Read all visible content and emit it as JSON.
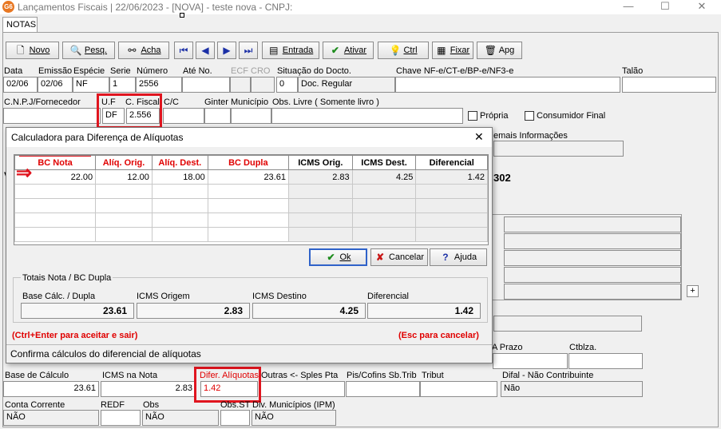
{
  "window": {
    "title": "Lançamentos Fiscais | 22/06/2023 - [NOVA] - teste nova - CNPJ:",
    "logo": "G6",
    "minimize": "—",
    "maximize": "☐",
    "close": "✕"
  },
  "tab": "NOTAS",
  "toolbar": {
    "novo": "Novo",
    "pesq": "Pesq.",
    "acha": "Acha",
    "entrada": "Entrada",
    "ativar": "Ativar",
    "ctrl": "Ctrl",
    "fixar": "Fixar",
    "apg": "Apg"
  },
  "row1": {
    "labels": {
      "data": "Data",
      "emissao": "Emissão",
      "especie": "Espécie",
      "serie": "Serie",
      "numero": "Número",
      "ate_no": "Até No.",
      "ecf": "ECF",
      "cro": "CRO",
      "situacao": "Situação do Docto.",
      "chave": "Chave NF-e/CT-e/BP-e/NF3-e",
      "talao": "Talão"
    },
    "values": {
      "data": "02/06",
      "emissao": "02/06",
      "especie": "NF",
      "serie": "1",
      "numero": "2556",
      "situacao_code": "0",
      "situacao_text": "Doc. Regular"
    }
  },
  "row2": {
    "labels": {
      "cnpj": "C.N.P.J/Fornecedor",
      "uf": "U.F",
      "cfiscal": "C. Fiscal",
      "cc": "C/C",
      "ginter": "Ginter",
      "municipio": "Município",
      "obs_livre": "Obs. Livre ( Somente livro )",
      "propria": "Própria",
      "consumidor": "Consumidor Final"
    },
    "values": {
      "uf": "DF",
      "cfiscal": "2.556"
    }
  },
  "background": {
    "demais": "emais Informações",
    "num302": "302",
    "plus": "+",
    "a_prazo": "A Prazo",
    "ctblza": "Ctblza."
  },
  "dialog": {
    "title": "Calculadora para Diferença de Alíquotas",
    "close": "✕",
    "arrow": "⇒",
    "columns": [
      "BC Nota",
      "Alíq. Orig.",
      "Alíq. Dest.",
      "BC Dupla",
      "ICMS Orig.",
      "ICMS Dest.",
      "Diferencial"
    ],
    "rows": [
      [
        "22.00",
        "12.00",
        "18.00",
        "23.61",
        "2.83",
        "4.25",
        "1.42"
      ]
    ],
    "ok": "Ok",
    "cancelar": "Cancelar",
    "ajuda": "Ajuda",
    "totals_title": "Totais Nota / BC Dupla",
    "totals_labels": [
      "Base Cálc. / Dupla",
      "ICMS Origem",
      "ICMS Destino",
      "Diferencial"
    ],
    "totals_values": [
      "23.61",
      "2.83",
      "4.25",
      "1.42"
    ],
    "hint_left": "(Ctrl+Enter para aceitar e sair)",
    "hint_right": "(Esc para cancelar)",
    "status": "Confirma cálculos do diferencial de alíquotas"
  },
  "bottom": {
    "labels": {
      "base": "Base de Cálculo",
      "icms_nota": "ICMS na Nota",
      "difer": "Difer. Alíquotas",
      "outras": "Outras <- Sples Pta",
      "piscofins": "Pis/Cofins Sb.Trib",
      "tributo": "Tribut",
      "difal": "Difal - Não Contribuinte",
      "conta": "Conta Corrente",
      "redf": "REDF",
      "obs": "Obs",
      "obsst": "Obs.ST",
      "div": "Div. Municípios (IPM)"
    },
    "values": {
      "base": "23.61",
      "icms_nota": "2.83",
      "difer": "1.42",
      "difal": "Não",
      "conta": "NÃO",
      "obs": "NÃO",
      "div": "NÃO"
    }
  },
  "colors": {
    "highlight": "#e0151f",
    "logo": "#e87722"
  }
}
